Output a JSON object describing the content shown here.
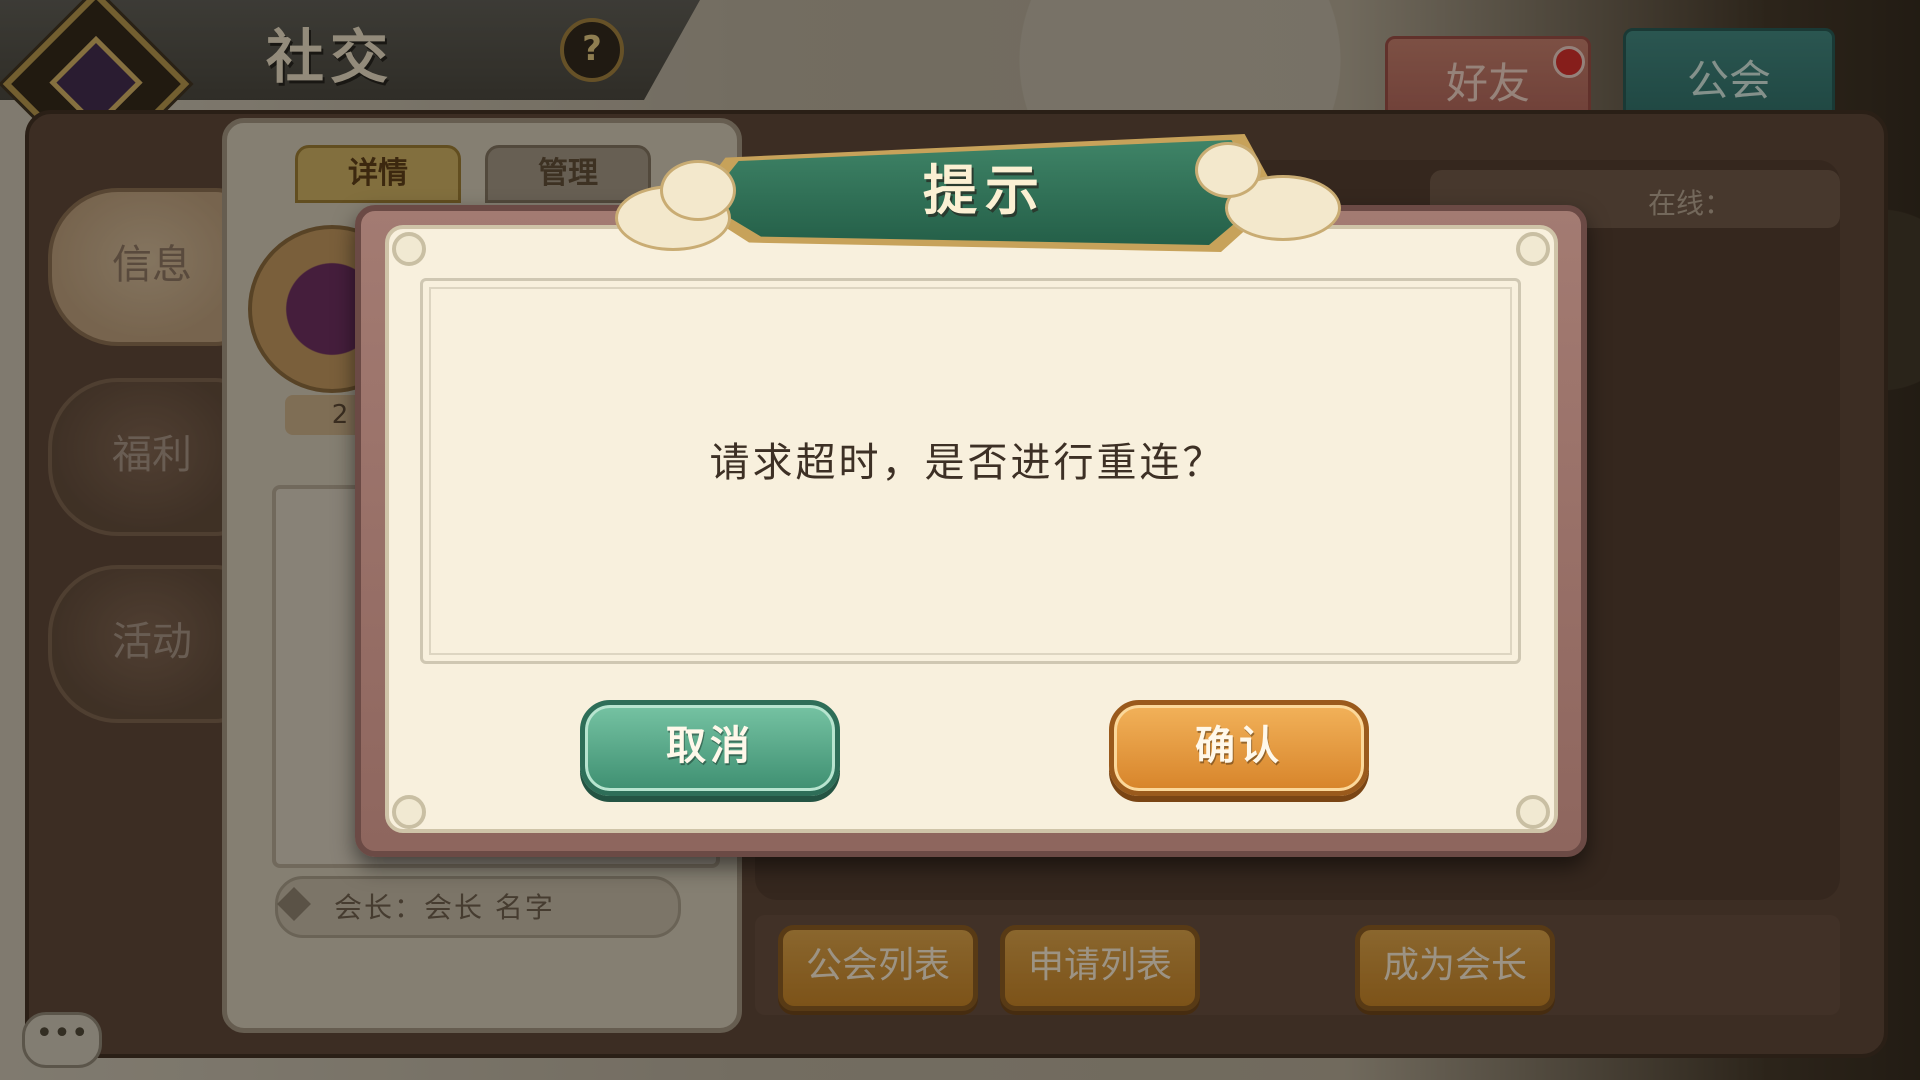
{
  "header": {
    "title": "社交",
    "help_glyph": "?"
  },
  "tabs": {
    "friends_label": "好友",
    "guild_label": "公会"
  },
  "sidebar": {
    "items": [
      {
        "label": "信息"
      },
      {
        "label": "福利"
      },
      {
        "label": "活动"
      }
    ]
  },
  "info_panel": {
    "tab_details": "详情",
    "tab_manage": "管理",
    "level_text": "2",
    "leader_text": "会长：会长  名字"
  },
  "guild_list": {
    "online_label": "在线："
  },
  "bottom_buttons": {
    "guild_list": "公会列表",
    "apply_list": "申请列表",
    "become_leader": "成为会长"
  },
  "chat": {
    "icon_text": "•••"
  },
  "dialog": {
    "title": "提示",
    "message": "请求超时，是否进行重连？",
    "cancel_label": "取消",
    "confirm_label": "确认"
  },
  "colors": {
    "cancel_green": "#3e8f71",
    "confirm_orange": "#d7842a",
    "banner_green": "#245f48"
  }
}
